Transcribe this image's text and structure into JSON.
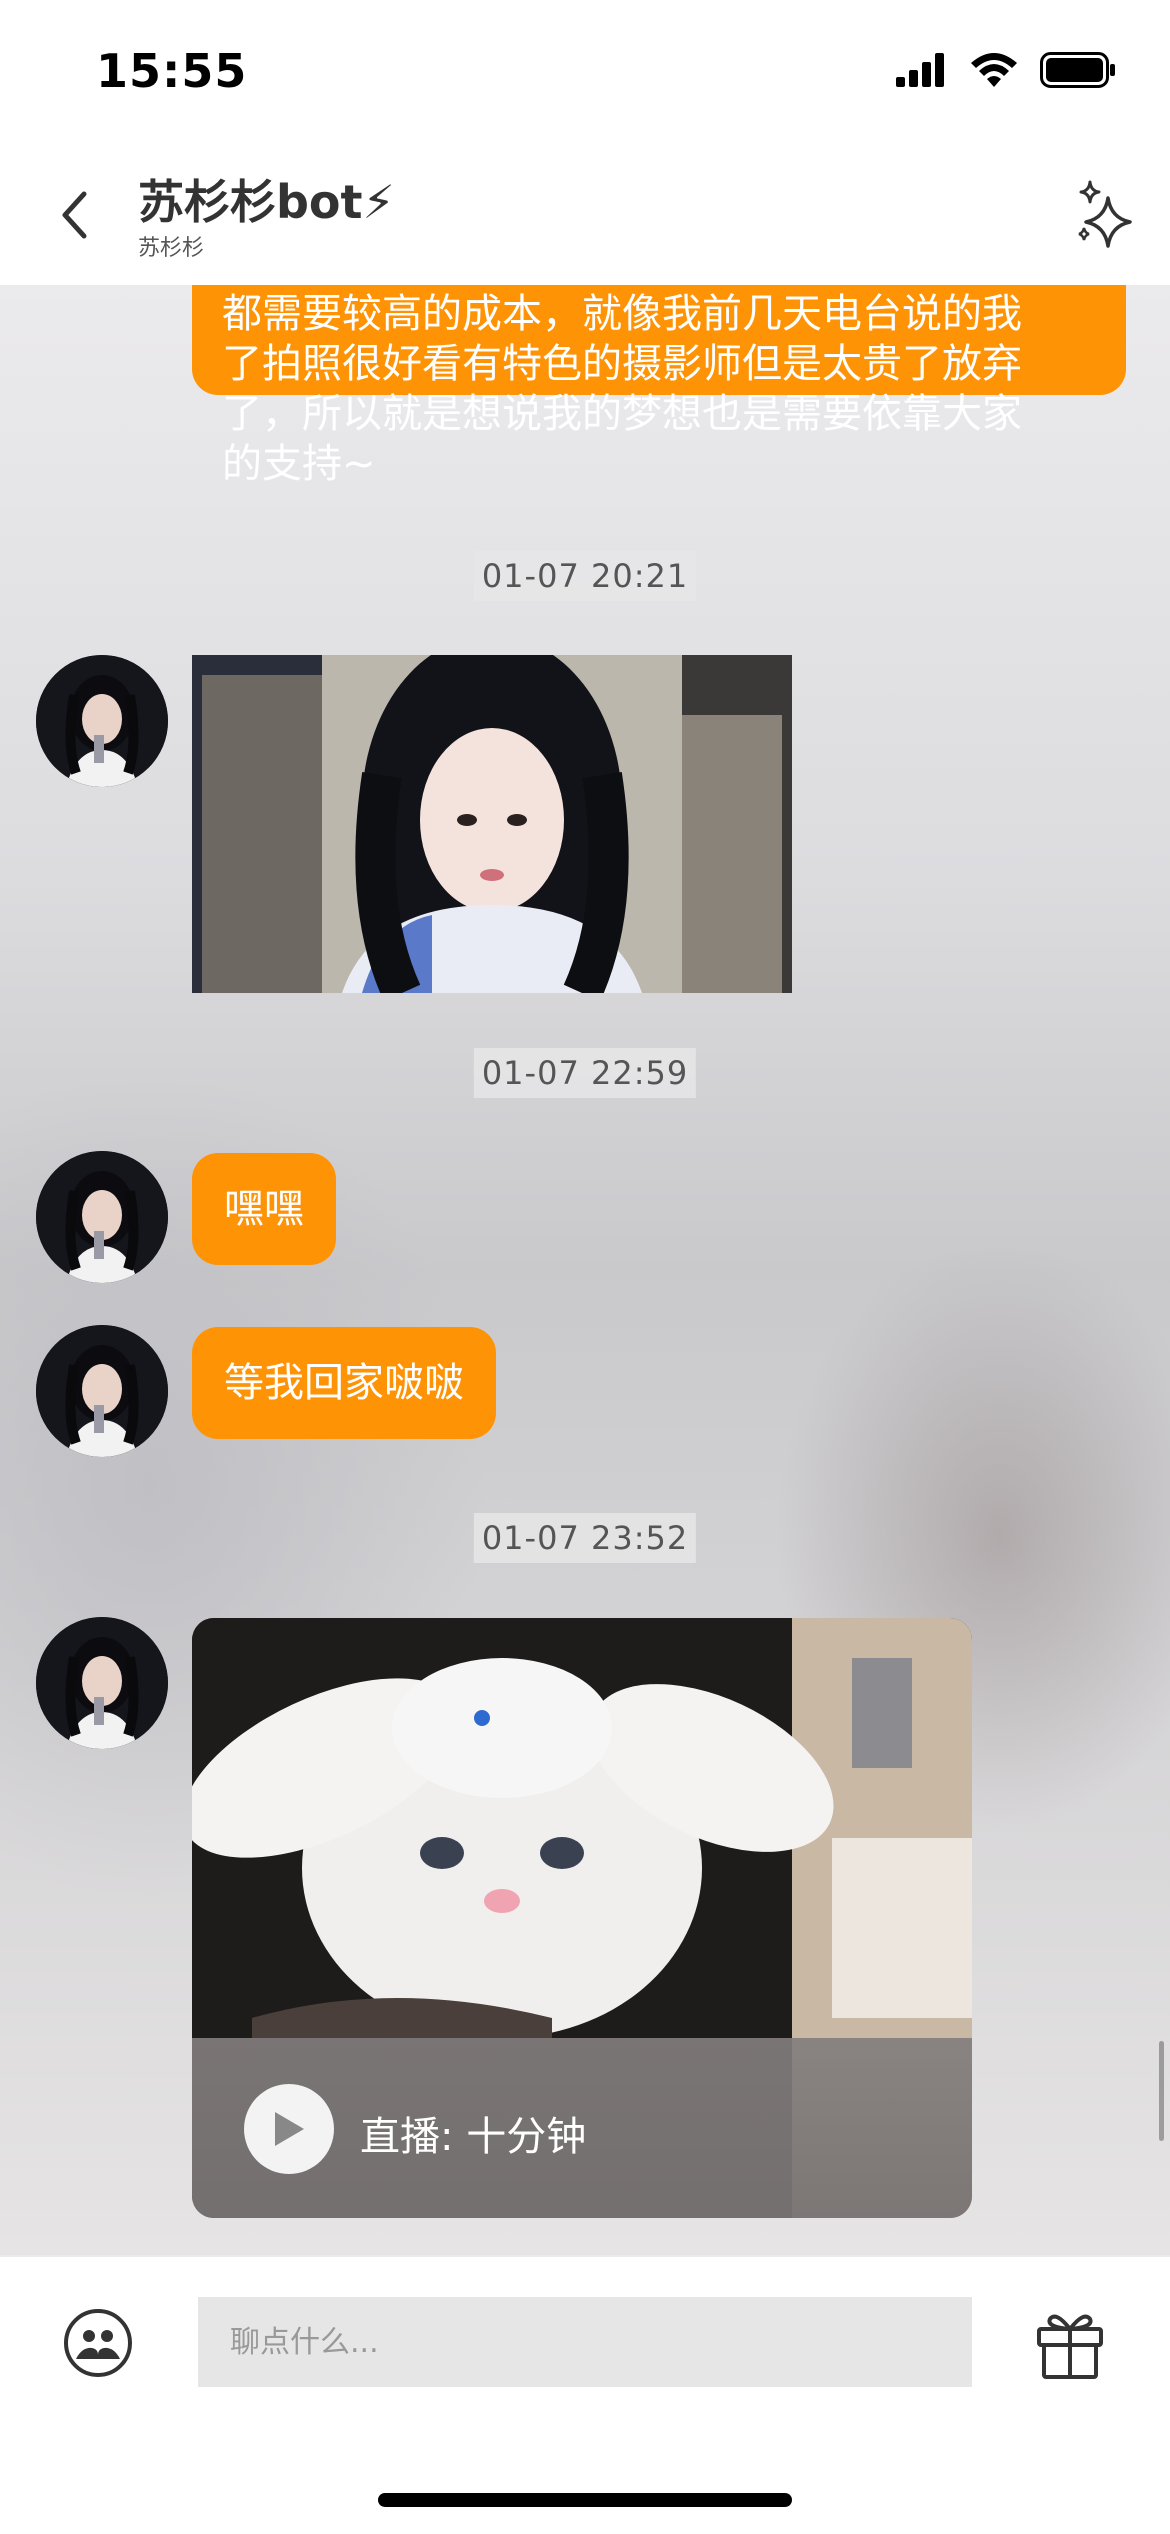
{
  "status_bar": {
    "time": "15:55"
  },
  "header": {
    "title": "苏杉杉bot⚡",
    "subtitle": "苏杉杉"
  },
  "messages": {
    "long_text_lines": [
      "都需要较高的成本，就像我前几天电台说的我",
      "了拍照很好看有特色的摄影师但是太贵了放弃",
      "了，所以就是想说我的梦想也是需要依靠大家",
      "的支持~"
    ],
    "ts1": "01-07 20:21",
    "ts2": "01-07 22:59",
    "msg_heihei": "嘿嘿",
    "msg_wait": "等我回家啵啵",
    "ts3": "01-07 23:52",
    "video_label": "直播: 十分钟"
  },
  "input": {
    "placeholder": "聊点什么..."
  },
  "colors": {
    "bubble": "#ff9306",
    "accent_bolt": "#ffa71a"
  },
  "icons": [
    "back-icon",
    "sparkle-icon",
    "emoji-icon",
    "gift-icon",
    "play-icon",
    "signal-icon",
    "wifi-icon",
    "battery-icon"
  ]
}
